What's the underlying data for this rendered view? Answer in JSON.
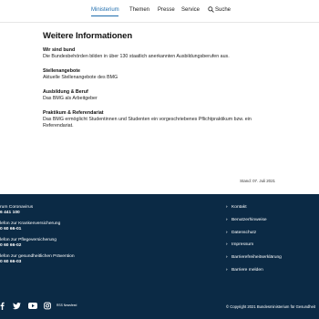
{
  "nav": {
    "items": [
      {
        "label": "Ministerium",
        "active": true
      },
      {
        "label": "Themen",
        "active": false
      },
      {
        "label": "Presse",
        "active": false
      },
      {
        "label": "Service",
        "active": false
      }
    ],
    "search_label": "Suche",
    "active_color": "#1f6dad"
  },
  "main": {
    "title": "Weitere Informationen",
    "items": [
      {
        "title": "Wir sind bund",
        "text": "Die Bundesbehörden bilden in über 130 staatlich anerkannten Ausbildungsberufen aus."
      },
      {
        "title": "Stellenangebote",
        "text": "Aktuelle Stellenangebote des BMG"
      },
      {
        "title": "Ausbildung & Beruf",
        "text": "Das BMG als Arbeitgeber"
      },
      {
        "title": "Praktikum & Referendariat",
        "text": "Das BMG ermöglicht Studentinnen und Studenten ein vorgeschriebenes Pflichtpraktikum bzw. ein Referendariat."
      }
    ],
    "stand": "Stand: 07. Juli 2021"
  },
  "footer": {
    "background": "#0b2a45",
    "hotlines": [
      {
        "label": "rum Coronavirus",
        "number": "6 441 100"
      },
      {
        "label": "lefon zur Krankenversicherung",
        "number": "0 60 66-01"
      },
      {
        "label": "lefon zur Pflegeversicherung",
        "number": "0 60 66-02"
      },
      {
        "label": "lefon zur gesundheitlichen Prävention",
        "number": "0 60 66-03"
      }
    ],
    "links": [
      "Kontakt",
      "Benutzerhinweise",
      "Datenschutz",
      "Impressum",
      "Barrierefreiheitserklärung",
      "Barriere melden"
    ],
    "social_icons": [
      "facebook-icon",
      "twitter-icon",
      "youtube-icon",
      "instagram-icon",
      "rss-icon"
    ],
    "rss_label": "RSS Newsfeed",
    "copyright": "© Copyright 2021 Bundesministerium für Gesundheit"
  }
}
